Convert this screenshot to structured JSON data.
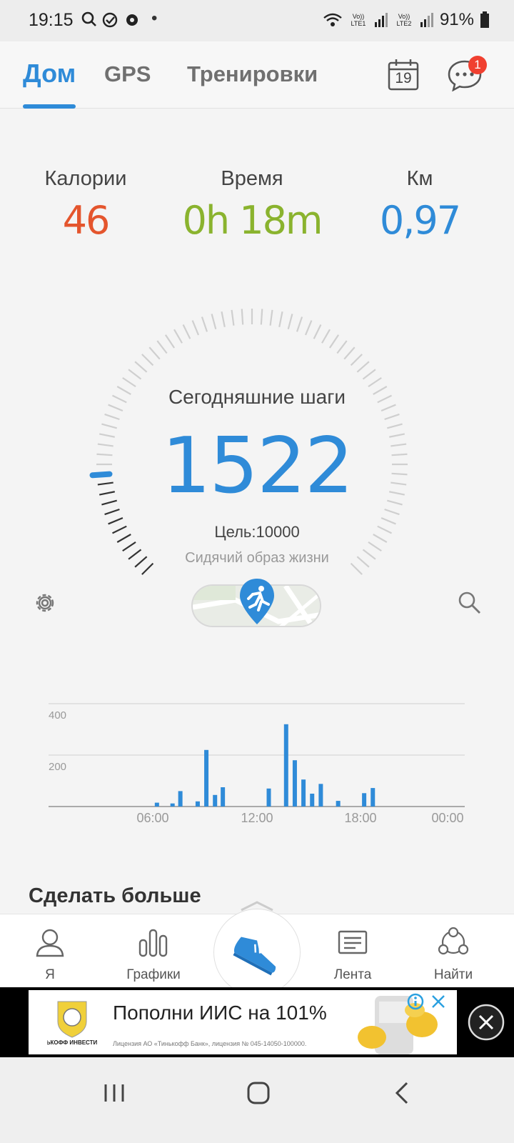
{
  "status_bar": {
    "time": "19:15",
    "dot": "•",
    "battery": "91%",
    "sim1_label": "Vo)) LTE1",
    "sim2_label": "Vo)) LTE2",
    "icons": [
      "search-icon",
      "check-circle-icon",
      "gear-icon",
      "wifi-icon",
      "signal-icon",
      "battery-icon"
    ]
  },
  "top_nav": {
    "tabs": [
      {
        "label": "Дом",
        "active": true
      },
      {
        "label": "GPS",
        "active": false
      },
      {
        "label": "Тренировки",
        "active": false
      }
    ],
    "calendar_day": "19",
    "notification_count": "1"
  },
  "stats": {
    "calories": {
      "label": "Калории",
      "value": "46",
      "color": "#e4552d"
    },
    "time": {
      "label": "Время",
      "value": "0h 18m",
      "color": "#8ab32e"
    },
    "distance": {
      "label": "Км",
      "value": "0,97",
      "color": "#2f8bd8"
    }
  },
  "steps": {
    "title": "Сегодняшние шаги",
    "count": "1522",
    "goal": "Цель:10000",
    "status": "Сидячий образ жизни",
    "progress_fraction": 0.1522,
    "accent": "#2f8bd8"
  },
  "chart_data": {
    "type": "bar",
    "x_ticks": [
      "06:00",
      "12:00",
      "18:00",
      "00:00"
    ],
    "y_ticks": [
      "400",
      "200"
    ],
    "ylim": [
      0,
      400
    ],
    "xlim_hours": [
      0,
      24
    ],
    "bars": [
      {
        "hour": 6.25,
        "value": 15
      },
      {
        "hour": 7.15,
        "value": 12
      },
      {
        "hour": 7.6,
        "value": 60
      },
      {
        "hour": 8.6,
        "value": 20
      },
      {
        "hour": 9.1,
        "value": 220
      },
      {
        "hour": 9.6,
        "value": 45
      },
      {
        "hour": 10.05,
        "value": 75
      },
      {
        "hour": 12.7,
        "value": 70
      },
      {
        "hour": 13.7,
        "value": 320
      },
      {
        "hour": 14.2,
        "value": 180
      },
      {
        "hour": 14.7,
        "value": 105
      },
      {
        "hour": 15.2,
        "value": 50
      },
      {
        "hour": 15.7,
        "value": 88
      },
      {
        "hour": 16.7,
        "value": 22
      },
      {
        "hour": 18.2,
        "value": 52
      },
      {
        "hour": 18.7,
        "value": 72
      }
    ],
    "bar_color": "#2f8bd8"
  },
  "more": {
    "title": "Сделать больше"
  },
  "bottom_nav": {
    "items": [
      {
        "label": "Я",
        "icon": "person-icon"
      },
      {
        "label": "Графики",
        "icon": "bar-chart-icon"
      },
      {
        "label": "",
        "icon": "running-shoe-icon"
      },
      {
        "label": "Лента",
        "icon": "feed-icon"
      },
      {
        "label": "Найти",
        "icon": "community-icon"
      }
    ]
  },
  "ad": {
    "brand": "ТИНЬКОФФ ИНВЕСТИЦИИ",
    "text": "Пополни ИИС на 101%",
    "small_print": "Лицензия АО «Тинькофф Банк», лицензия № 045-14050-100000."
  }
}
